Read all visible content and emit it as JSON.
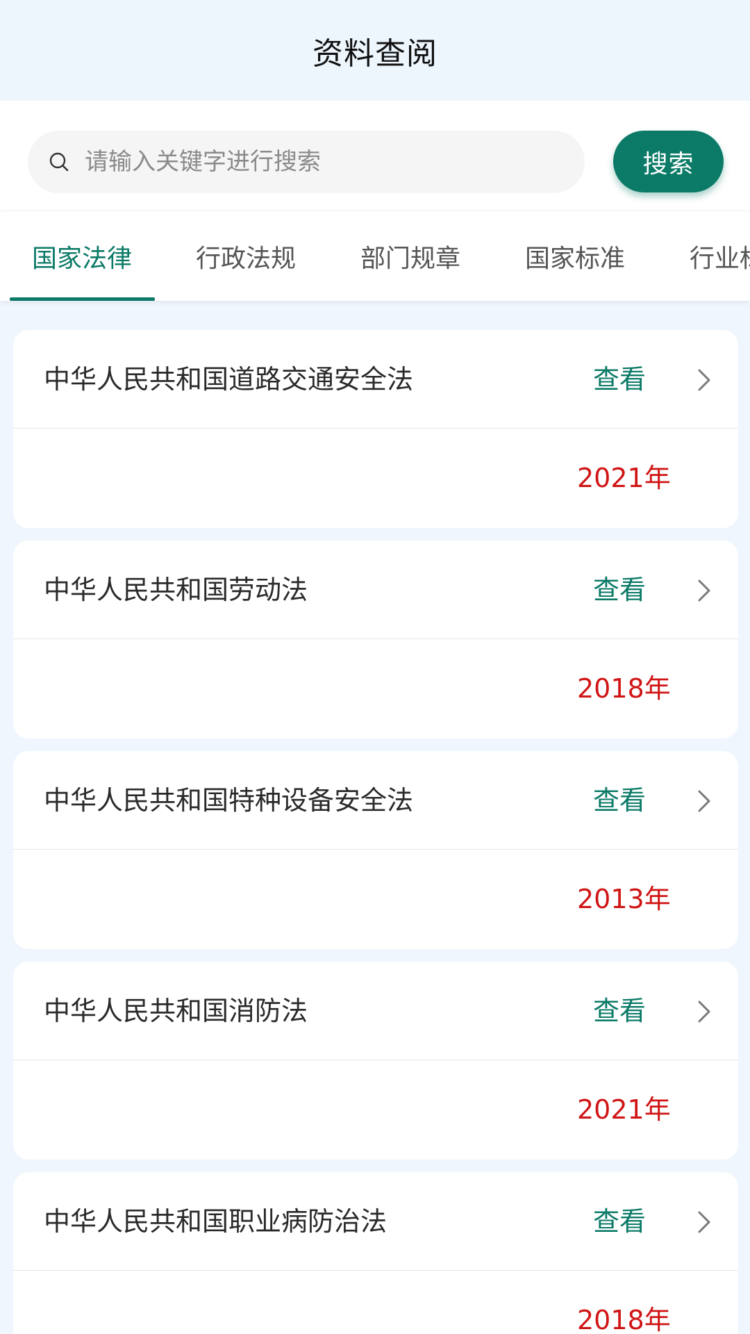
{
  "header": {
    "title": "资料查阅"
  },
  "search": {
    "placeholder": "请输入关键字进行搜索",
    "value": "",
    "button_label": "搜索"
  },
  "tabs": [
    {
      "label": "国家法律",
      "active": true
    },
    {
      "label": "行政法规",
      "active": false
    },
    {
      "label": "部门规章",
      "active": false
    },
    {
      "label": "国家标准",
      "active": false
    },
    {
      "label": "行业标准",
      "active": false
    }
  ],
  "laws": [
    {
      "title": "中华人民共和国道路交通安全法",
      "action": "查看",
      "year": "2021年"
    },
    {
      "title": "中华人民共和国劳动法",
      "action": "查看",
      "year": "2018年"
    },
    {
      "title": "中华人民共和国特种设备安全法",
      "action": "查看",
      "year": "2013年"
    },
    {
      "title": "中华人民共和国消防法",
      "action": "查看",
      "year": "2021年"
    },
    {
      "title": "中华人民共和国职业病防治法",
      "action": "查看",
      "year": "2018年"
    }
  ],
  "colors": {
    "accent": "#0b7a67",
    "year_text": "#d01515",
    "page_background": "#eff6fd"
  },
  "icons": {
    "search": "search-icon",
    "row_arrow": "chevron-right-icon"
  }
}
